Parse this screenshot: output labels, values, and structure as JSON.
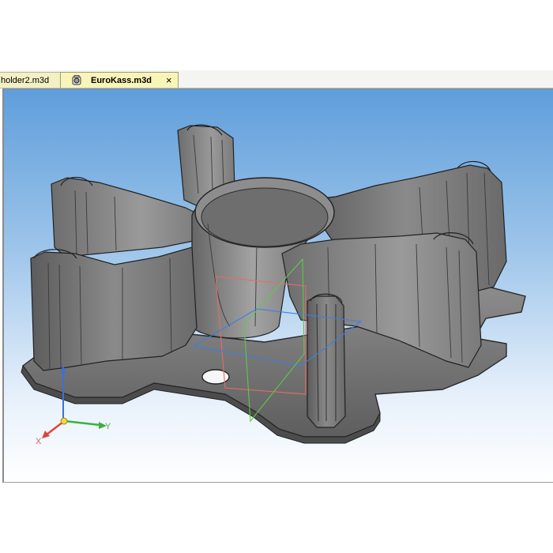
{
  "tabs": [
    {
      "label": "holder2.m3d",
      "active": false
    },
    {
      "label": "EuroKass.m3d",
      "active": true,
      "close_symbol": "×"
    }
  ],
  "viewport": {
    "background_top": "#5f9edb",
    "background_bottom": "#ffffff",
    "model_color": "#767676"
  },
  "axes": {
    "x_label": "X",
    "y_label": "Y",
    "x_color": "#e0443b",
    "y_color": "#3cb043",
    "z_color": "#3f6fd6"
  }
}
